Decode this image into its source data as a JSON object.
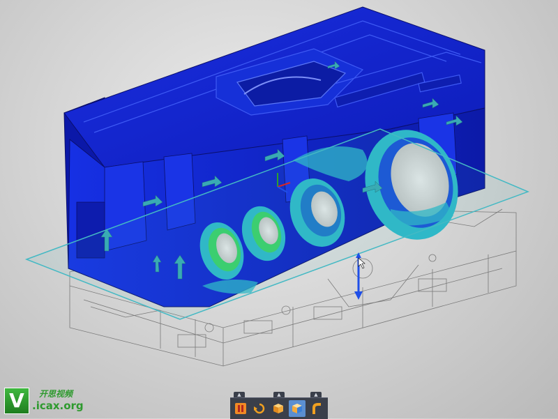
{
  "viewport": {
    "label": "3D model viewport - engine block stress analysis",
    "colors": {
      "body_dark": "#0a16b8",
      "body_mid": "#1428d8",
      "body_light": "#2c46f0",
      "stress_cyan": "#2fb8c8",
      "stress_green": "#3cd06a",
      "arrow": "#39aab4",
      "section_plane": "#44b9c4",
      "wireframe": "#555555",
      "load_arrow": "#1f4fe8"
    }
  },
  "toolbar": {
    "buttons": [
      {
        "icon": "pause-icon",
        "name": "pause"
      },
      {
        "icon": "rotate-icon",
        "name": "orbit"
      },
      {
        "icon": "box-icon",
        "name": "view-cube"
      },
      {
        "icon": "section-view-icon",
        "name": "section-view"
      },
      {
        "icon": "pipe-icon",
        "name": "display-style"
      }
    ],
    "flyout_glyph": "▲"
  },
  "watermark": {
    "logo_letter": "V",
    "chinese_text": "开思视频",
    "site": ".icax.org"
  }
}
